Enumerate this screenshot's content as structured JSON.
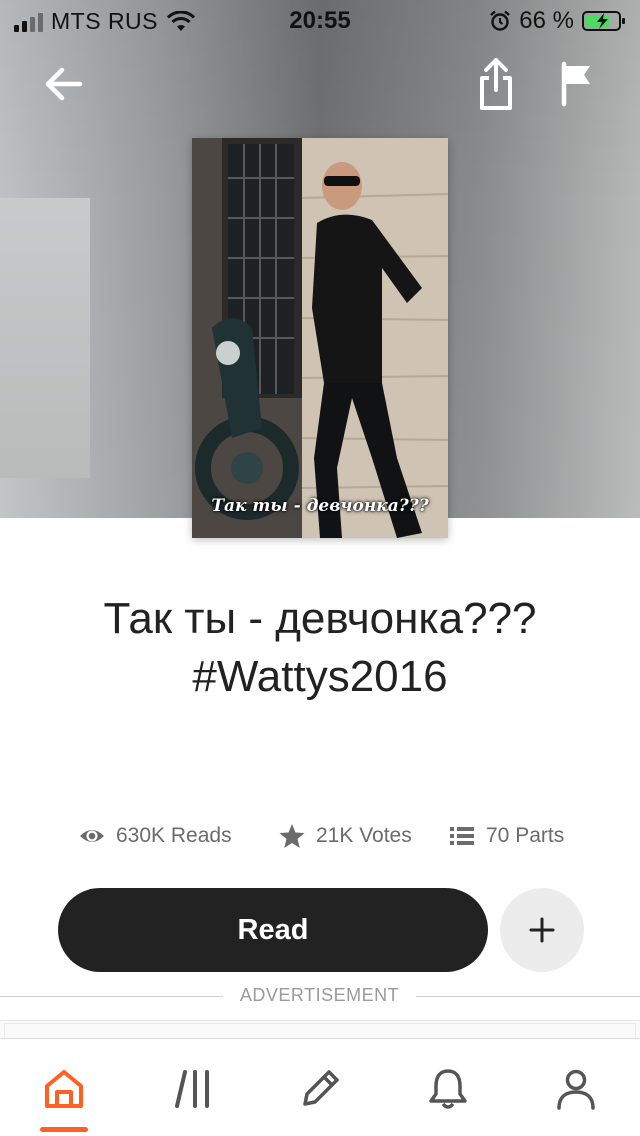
{
  "status_bar": {
    "carrier": "MTS RUS",
    "time": "20:55",
    "battery_percent": "66 %"
  },
  "top_actions": {
    "back_icon": "arrow-left-icon",
    "share_icon": "share-icon",
    "flag_icon": "flag-icon"
  },
  "story": {
    "cover_caption": "Так ты - девчонка???",
    "title": "Так ты - девчонка??? #Wattys2016",
    "stats": {
      "reads": "630K Reads",
      "votes": "21K Votes",
      "parts": "70 Parts"
    }
  },
  "actions": {
    "read_label": "Read",
    "add_icon": "plus-icon"
  },
  "advertisement_label": "ADVERTISEMENT",
  "bottom_nav": {
    "items": [
      {
        "name": "home",
        "icon": "home-icon",
        "active": true
      },
      {
        "name": "library",
        "icon": "library-icon",
        "active": false
      },
      {
        "name": "write",
        "icon": "pencil-icon",
        "active": false
      },
      {
        "name": "notifications",
        "icon": "bell-icon",
        "active": false
      },
      {
        "name": "profile",
        "icon": "person-icon",
        "active": false
      }
    ]
  },
  "colors": {
    "accent": "#ff6122",
    "read_button": "#222222",
    "stat_text": "#6b6b6b"
  }
}
